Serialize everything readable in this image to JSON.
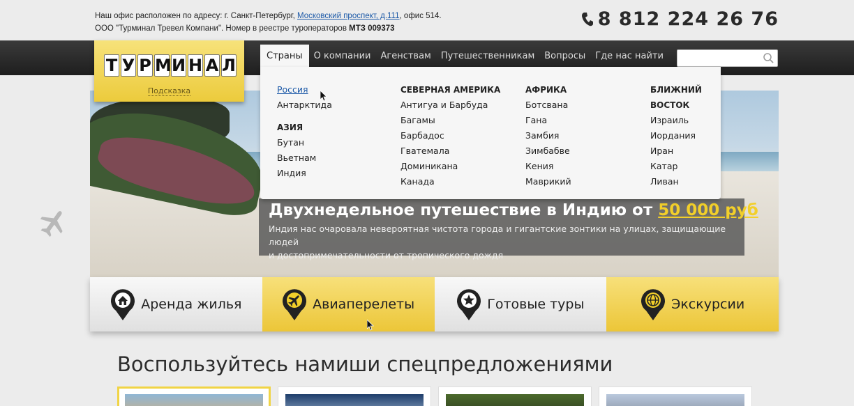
{
  "header": {
    "address_prefix": "Наш офис расположен по адресу:  г. Санкт-Петербург,",
    "address_link": "Московский проспект, д.111",
    "address_suffix": ", офис 514.",
    "company_text": "ООО \"Турминал Тревел Компани\". Номер в реестре туроператоров",
    "registry_number": "МТЗ 009373",
    "phone": "8 812 224 26 76"
  },
  "logo": {
    "letters": [
      "Т",
      "У",
      "Р",
      "М",
      "И",
      "Н",
      "А",
      "Л"
    ],
    "hint": "Подсказка"
  },
  "nav": {
    "items": [
      "Страны",
      "О компании",
      "Агенствам",
      "Путешественникам",
      "Вопросы",
      "Где нас найти"
    ],
    "active_index": 0
  },
  "search": {
    "placeholder": "",
    "value": ""
  },
  "dropdown": {
    "col1": {
      "top": [
        "Россия",
        "Антарктида"
      ],
      "heading": "АЗИЯ",
      "items": [
        "Бутан",
        "Вьетнам",
        "Индия"
      ]
    },
    "col2": {
      "heading": "СЕВЕРНАЯ АМЕРИКА",
      "items": [
        "Антигуа и Барбуда",
        "Багамы",
        "Барбадос",
        "Гватемала",
        "Доминикана",
        "Канада"
      ]
    },
    "col3": {
      "heading": "АФРИКА",
      "items": [
        "Ботсвана",
        "Гана",
        "Замбия",
        "Зимбабве",
        "Кения",
        "Маврикий"
      ]
    },
    "col4": {
      "heading_line1": "БЛИЖНИЙ",
      "heading_line2": "ВОСТОК",
      "items": [
        "Израиль",
        "Иордания",
        "Иран",
        "Катар",
        "Ливан"
      ]
    }
  },
  "hero": {
    "title": "Двухнедельное путешествие в Индию от",
    "price": "50 000 руб",
    "text_line1": "Индия нас очаровала невероятная чистота города и гигантские зонтики на улицах, защищающие людей",
    "text_line2": "и достопримечательности от тропического дождя"
  },
  "tabs": [
    {
      "label": "Аренда жилья",
      "icon": "home-icon",
      "style": "grey"
    },
    {
      "label": "Авиаперелеты",
      "icon": "airplane-icon",
      "style": "yellow"
    },
    {
      "label": "Готовые туры",
      "icon": "star-icon",
      "style": "grey"
    },
    {
      "label": "Экскурсии",
      "icon": "globe-icon",
      "style": "yellow"
    }
  ],
  "offers": {
    "title": "Воспользуйтесь намиши спецпредложениями"
  },
  "colors": {
    "accent": "#f2cf2a",
    "nav_bg": "#2a2a2a",
    "link": "#1d5aa8"
  }
}
